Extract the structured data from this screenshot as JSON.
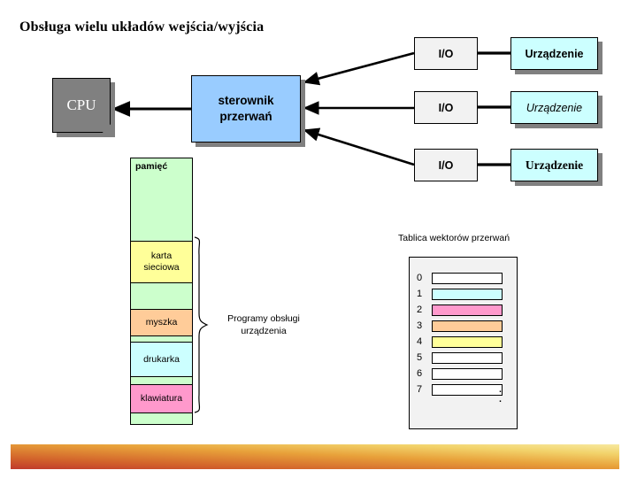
{
  "slide": {
    "title": "Obsługa wielu układów wejścia/wyjścia",
    "background": "#FFFFFF"
  },
  "cpu": {
    "label": "CPU",
    "fill": "#808080",
    "text_color": "#FFFFFF"
  },
  "controller": {
    "line1": "sterownik",
    "line2": "przerwań",
    "fill": "#99CCFF"
  },
  "io_boxes": [
    {
      "label": "I/O",
      "fill": "#F2F2F2"
    },
    {
      "label": "I/O",
      "fill": "#F2F2F2"
    },
    {
      "label": "I/O",
      "fill": "#F2F2F2"
    }
  ],
  "devices": [
    {
      "label": "Urządzenie",
      "fill": "#CCFFFF",
      "style": "bold-sans"
    },
    {
      "label": "Urządzenie",
      "fill": "#CCFFFF",
      "style": "italic-sans"
    },
    {
      "label": "Urządzenie",
      "fill": "#CCFFFF",
      "style": "bold-serif"
    }
  ],
  "memory": {
    "title": "pamięć",
    "fill": "#CCFFCC",
    "segments": [
      {
        "label": "",
        "fill": "#CCFFCC"
      },
      {
        "label": "karta sieciowa",
        "line1": "karta",
        "line2": "sieciowa",
        "fill": "#FFFF99"
      },
      {
        "label": "",
        "fill": "#CCFFCC"
      },
      {
        "label": "myszka",
        "fill": "#FFCC99"
      },
      {
        "label": "",
        "fill": "#CCFFCC"
      },
      {
        "label": "drukarka",
        "fill": "#CCFFFF"
      },
      {
        "label": "",
        "fill": "#CCFFCC"
      },
      {
        "label": "klawiatura",
        "fill": "#FF99CC"
      },
      {
        "label": "",
        "fill": "#CCFFCC"
      }
    ]
  },
  "driver_label": {
    "line1": "Programy obsługi",
    "line2": "urządzenia"
  },
  "vector_table": {
    "title": "Tablica wektorów przerwań",
    "fill": "#F2F2F2",
    "dots": "·\n·",
    "rows": [
      {
        "index": "0",
        "fill": "#FFFFFF"
      },
      {
        "index": "1",
        "fill": "#CCFFFF"
      },
      {
        "index": "2",
        "fill": "#FF99CC"
      },
      {
        "index": "3",
        "fill": "#FFCC99"
      },
      {
        "index": "4",
        "fill": "#FFFF99"
      },
      {
        "index": "5",
        "fill": "#FFFFFF"
      },
      {
        "index": "6",
        "fill": "#FFFFFF"
      },
      {
        "index": "7",
        "fill": "#FFFFFF"
      }
    ]
  },
  "footer": {
    "gradient_from": "#C0392B",
    "gradient_to": "#F7E9A0"
  }
}
